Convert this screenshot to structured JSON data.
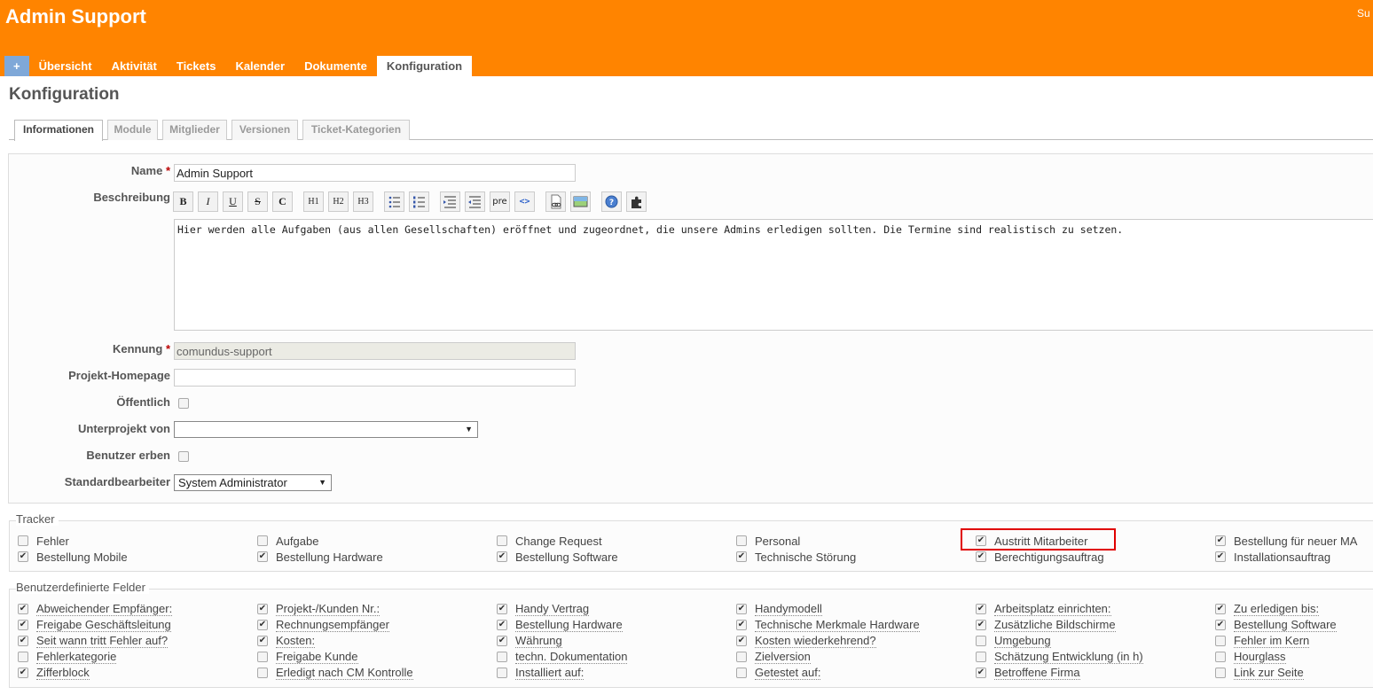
{
  "header": {
    "title": "Admin Support",
    "search_label": "Su"
  },
  "main_menu": {
    "new_label": "+",
    "items": [
      "Übersicht",
      "Aktivität",
      "Tickets",
      "Kalender",
      "Dokumente",
      "Konfiguration"
    ],
    "selected": "Konfiguration"
  },
  "page_title": "Konfiguration",
  "tabs": [
    "Informationen",
    "Module",
    "Mitglieder",
    "Versionen",
    "Ticket-Kategorien"
  ],
  "form": {
    "name_label": "Name",
    "name_value": "Admin Support",
    "required_marker": "*",
    "description_label": "Beschreibung",
    "description_text": "Hier werden alle Aufgaben (aus allen Gesellschaften) eröffnet und zugeordnet, die unsere Admins erledigen sollten. Die Termine sind realistisch zu setzen.",
    "toolbar": [
      "B",
      "I",
      "U",
      "S",
      "C",
      "H1",
      "H2",
      "H3",
      "ul",
      "ol",
      "indent",
      "outdent",
      "pre",
      "<>",
      "link",
      "image",
      "help",
      "macro"
    ],
    "identifier_label": "Kennung",
    "identifier_value": "comundus-support",
    "homepage_label": "Projekt-Homepage",
    "homepage_value": "",
    "public_label": "Öffentlich",
    "public_checked": false,
    "parent_label": "Unterprojekt von",
    "parent_value": "",
    "inherit_label": "Benutzer erben",
    "inherit_checked": false,
    "assignee_label": "Standardbearbeiter",
    "assignee_value": "System Administrator"
  },
  "trackers": {
    "legend": "Tracker",
    "items": [
      {
        "label": "Fehler",
        "checked": false
      },
      {
        "label": "Aufgabe",
        "checked": false
      },
      {
        "label": "Change Request",
        "checked": false
      },
      {
        "label": "Personal",
        "checked": false
      },
      {
        "label": "Austritt Mitarbeiter",
        "checked": true
      },
      {
        "label": "Bestellung für neuer MA",
        "checked": true
      },
      {
        "label": "Bestellung Mobile",
        "checked": true
      },
      {
        "label": "Bestellung Hardware",
        "checked": true
      },
      {
        "label": "Bestellung Software",
        "checked": true
      },
      {
        "label": "Technische Störung",
        "checked": true
      },
      {
        "label": "Berechtigungsauftrag",
        "checked": true
      },
      {
        "label": "Installationsauftrag",
        "checked": true
      }
    ]
  },
  "custom_fields": {
    "legend": "Benutzerdefinierte Felder",
    "items": [
      {
        "label": "Abweichender Empfänger:",
        "checked": true
      },
      {
        "label": "Projekt-/Kunden Nr.:",
        "checked": true
      },
      {
        "label": "Handy Vertrag",
        "checked": true
      },
      {
        "label": "Handymodell",
        "checked": true
      },
      {
        "label": "Arbeitsplatz einrichten:",
        "checked": true
      },
      {
        "label": "Zu erledigen bis:",
        "checked": true
      },
      {
        "label": "Freigabe Geschäftsleitung",
        "checked": true
      },
      {
        "label": "Rechnungsempfänger",
        "checked": true
      },
      {
        "label": "Bestellung Hardware",
        "checked": true
      },
      {
        "label": "Technische Merkmale Hardware",
        "checked": true
      },
      {
        "label": "Zusätzliche Bildschirme",
        "checked": true
      },
      {
        "label": "Bestellung Software",
        "checked": true
      },
      {
        "label": "Seit wann tritt Fehler auf?",
        "checked": true
      },
      {
        "label": "Kosten:",
        "checked": true
      },
      {
        "label": "Währung",
        "checked": true
      },
      {
        "label": "Kosten wiederkehrend?",
        "checked": true
      },
      {
        "label": "Umgebung",
        "checked": false
      },
      {
        "label": "Fehler im Kern",
        "checked": false
      },
      {
        "label": "Fehlerkategorie",
        "checked": false
      },
      {
        "label": "Freigabe Kunde",
        "checked": false
      },
      {
        "label": "techn. Dokumentation",
        "checked": false
      },
      {
        "label": "Zielversion",
        "checked": false
      },
      {
        "label": "Schätzung Entwicklung (in h)",
        "checked": false
      },
      {
        "label": "Hourglass",
        "checked": false
      },
      {
        "label": "Zifferblock",
        "checked": true
      },
      {
        "label": "Erledigt nach CM Kontrolle",
        "checked": false
      },
      {
        "label": "Installiert auf:",
        "checked": false
      },
      {
        "label": "Getestet auf:",
        "checked": false
      },
      {
        "label": "Betroffene Firma",
        "checked": true
      },
      {
        "label": "Link zur Seite",
        "checked": false
      }
    ]
  },
  "colors": {
    "header": "#ff8400",
    "new_button": "#7fa8d8",
    "highlight": "#e00000"
  }
}
